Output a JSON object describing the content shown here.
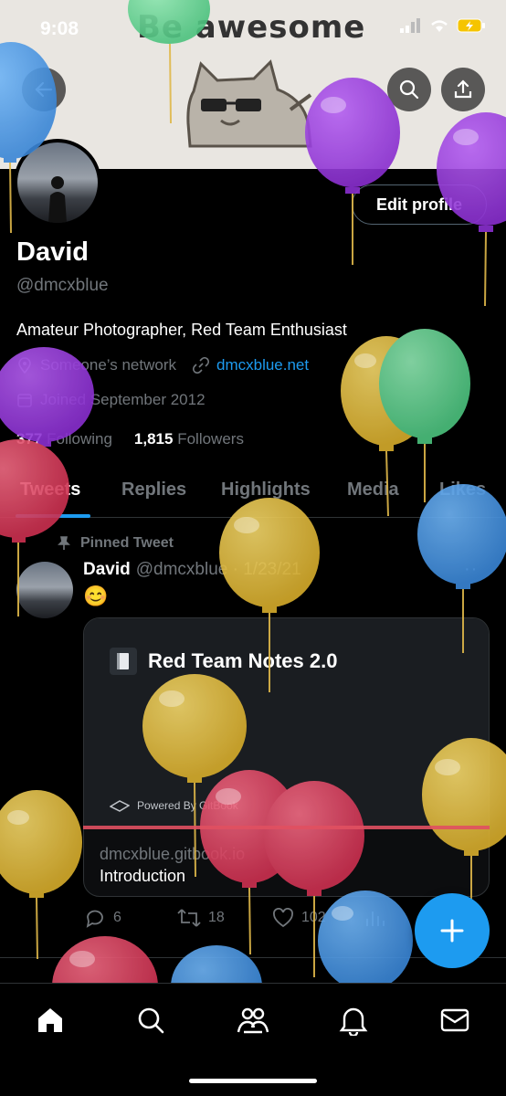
{
  "status_bar": {
    "time": "9:08"
  },
  "banner": {
    "text": "Be awesome"
  },
  "header": {
    "back_icon": "arrow-left-icon",
    "search_icon": "search-icon",
    "share_icon": "share-icon"
  },
  "profile": {
    "edit_button": "Edit profile",
    "name": "David",
    "handle": "@dmcxblue",
    "bio": "Amateur Photographer, Red Team Enthusiast",
    "location": "Someone’s network",
    "website": "dmcxblue.net",
    "joined": "Joined September 2012",
    "following_count": "377",
    "following_label": "Following",
    "followers_count": "1,815",
    "followers_label": "Followers"
  },
  "tabs": [
    "Tweets",
    "Replies",
    "Highlights",
    "Media",
    "Likes"
  ],
  "tweet": {
    "pinned_label": "Pinned Tweet",
    "author": "David",
    "meta": "@dmcxblue · 1/23/21",
    "emoji": "😊",
    "card": {
      "title": "Red Team Notes 2.0",
      "powered_by": "Powered By GitBook",
      "domain": "dmcxblue.gitbook.io",
      "description": "Introduction"
    },
    "replies": "6",
    "retweets": "18",
    "likes": "102"
  },
  "colors": {
    "accent": "#1d9bf0",
    "background": "#000000",
    "muted": "#71767b"
  },
  "bottom_nav": [
    "home-icon",
    "search-icon",
    "communities-icon",
    "notifications-icon",
    "messages-icon"
  ]
}
